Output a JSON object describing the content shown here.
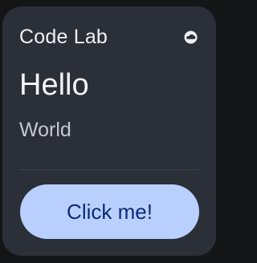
{
  "card": {
    "title": "Code Lab",
    "icon": "cloud-icon",
    "headline": "Hello",
    "subtitle": "World",
    "button_label": "Click me!"
  },
  "colors": {
    "background": "#141517",
    "card": "#2b2f38",
    "button": "#b9d0ff",
    "button_text": "#0a2b75"
  }
}
